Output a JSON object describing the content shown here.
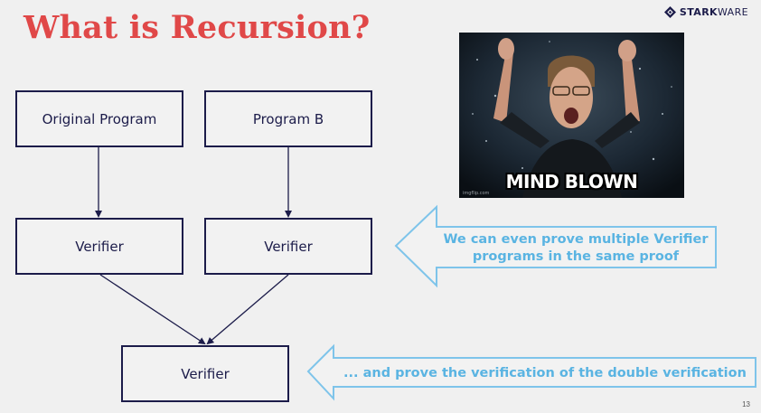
{
  "slide": {
    "title": "What is Recursion?",
    "logo": {
      "bold": "STARK",
      "thin": "WARE"
    },
    "page_number": "13"
  },
  "boxes": {
    "original_program": "Original Program",
    "program_b": "Program B",
    "verifier_left": "Verifier",
    "verifier_right": "Verifier",
    "verifier_bottom": "Verifier"
  },
  "meme": {
    "caption": "MIND BLOWN",
    "watermark": "imgflip.com"
  },
  "callouts": {
    "top_line1": "We can even prove multiple Verifier",
    "top_line2": "programs in the same proof",
    "bottom": "... and prove the verification of the double verification"
  },
  "colors": {
    "title": "#e04848",
    "box_border": "#1c1c4a",
    "callout": "#5ab4e2",
    "background": "#f0f0f0"
  }
}
